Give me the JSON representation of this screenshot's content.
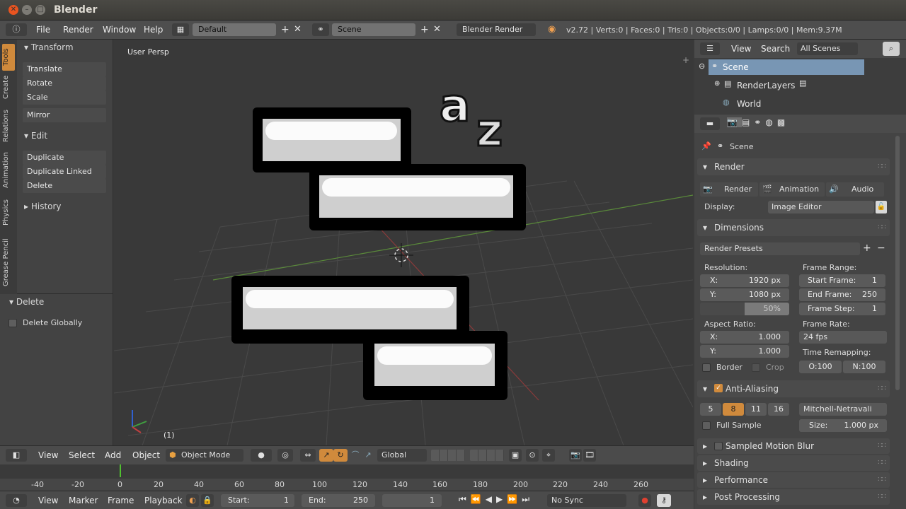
{
  "window": {
    "title": "Blender"
  },
  "menu": {
    "file": "File",
    "render": "Render",
    "window": "Window",
    "help": "Help",
    "layout": "Default",
    "scene": "Scene",
    "engine": "Blender Render",
    "stats": "v2.72 | Verts:0 | Faces:0 | Tris:0 | Objects:0/0 | Lamps:0/0 | Mem:9.37M"
  },
  "tabs": {
    "tools": "Tools",
    "create": "Create",
    "relations": "Relations",
    "animation": "Animation",
    "physics": "Physics",
    "grease": "Grease Pencil"
  },
  "tools": {
    "transform": "Transform",
    "translate": "Translate",
    "rotate": "Rotate",
    "scale": "Scale",
    "mirror": "Mirror",
    "edit": "Edit",
    "duplicate": "Duplicate",
    "duplicate_linked": "Duplicate Linked",
    "delete": "Delete",
    "history": "History"
  },
  "operator": {
    "title": "Delete",
    "globally": "Delete Globally"
  },
  "viewport": {
    "label": "User Persp",
    "frame": "(1)"
  },
  "vpbar": {
    "view": "View",
    "select": "Select",
    "add": "Add",
    "object": "Object",
    "mode": "Object Mode",
    "orientation": "Global"
  },
  "timeline": {
    "ticks": [
      "-40",
      "-20",
      "0",
      "20",
      "40",
      "60",
      "80",
      "100",
      "120",
      "140",
      "160",
      "180",
      "200",
      "220",
      "240",
      "260"
    ]
  },
  "tlbar": {
    "view": "View",
    "marker": "Marker",
    "frame": "Frame",
    "playback": "Playback",
    "start_label": "Start:",
    "start": "1",
    "end_label": "End:",
    "end": "250",
    "current": "1",
    "sync": "No Sync"
  },
  "outliner": {
    "view": "View",
    "search": "Search",
    "filter": "All Scenes",
    "scene": "Scene",
    "renderlayers": "RenderLayers",
    "world": "World"
  },
  "props": {
    "context": "Scene",
    "render": {
      "title": "Render",
      "render_btn": "Render",
      "animation_btn": "Animation",
      "audio_btn": "Audio",
      "display_label": "Display:",
      "display": "Image Editor"
    },
    "dimensions": {
      "title": "Dimensions",
      "presets": "Render Presets",
      "resolution": "Resolution:",
      "x": "X:",
      "x_val": "1920 px",
      "y": "Y:",
      "y_val": "1080 px",
      "pct": "50%",
      "frame_range": "Frame Range:",
      "start": "Start Frame:",
      "start_val": "1",
      "end": "End Frame:",
      "end_val": "250",
      "step": "Frame Step:",
      "step_val": "1",
      "aspect": "Aspect Ratio:",
      "ax": "X:",
      "ax_val": "1.000",
      "ay": "Y:",
      "ay_val": "1.000",
      "framerate": "Frame Rate:",
      "fps": "24 fps",
      "remap": "Time Remapping:",
      "old": "O:100",
      "new": "N:100",
      "border": "Border",
      "crop": "Crop"
    },
    "aa": {
      "title": "Anti-Aliasing",
      "s5": "5",
      "s8": "8",
      "s11": "11",
      "s16": "16",
      "filter": "Mitchell-Netravali",
      "full": "Full Sample",
      "size_label": "Size:",
      "size": "1.000 px"
    },
    "closed": {
      "smb": "Sampled Motion Blur",
      "shading": "Shading",
      "performance": "Performance",
      "post": "Post Processing"
    }
  },
  "colors": {
    "accent": "#d08a3c",
    "header": "#4e4e4e",
    "viewport": "#393939"
  }
}
